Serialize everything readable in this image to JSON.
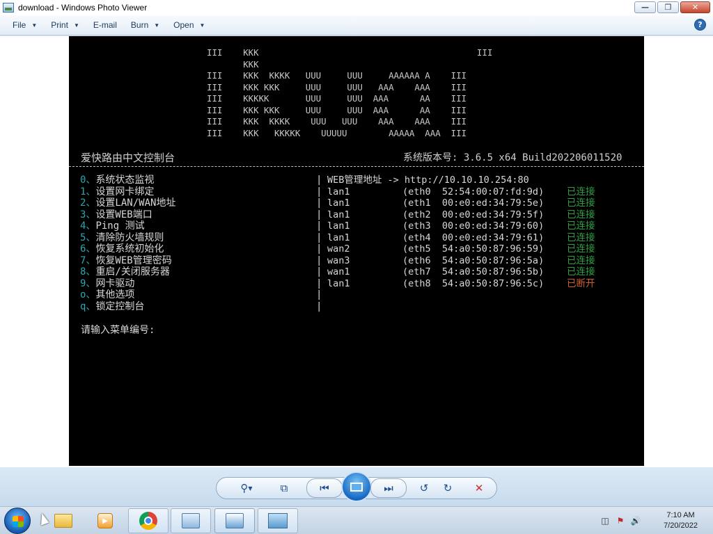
{
  "window": {
    "title": "download - Windows Photo Viewer"
  },
  "menubar": {
    "items": [
      "File",
      "Print",
      "E-mail",
      "Burn",
      "Open"
    ]
  },
  "console": {
    "logo_lines": [
      "III    KKK                                          III",
      "       KKK",
      "III    KKK  KKKK   UUU     UUU     AAAAAA A    III",
      "III    KKK KKK     UUU     UUU   AAA    AAA    III",
      "III    KKKKK       UUU     UUU  AAA      AA    III",
      "III    KKK KKK     UUU     UUU  AAA      AA    III",
      "III    KKK  KKKK    UUU   UUU    AAA    AAA    III",
      "III    KKK   KKKKK    UUUUU        AAAAA  AAA  III"
    ],
    "title": "爱快路由中文控制台",
    "version": "系统版本号: 3.6.5 x64 Build202206011520",
    "menu": [
      {
        "key": "0、",
        "label": "系统状态监视"
      },
      {
        "key": "1、",
        "label": "设置网卡绑定"
      },
      {
        "key": "2、",
        "label": "设置LAN/WAN地址"
      },
      {
        "key": "3、",
        "label": "设置WEB端口"
      },
      {
        "key": "4、",
        "label": "Ping 测试"
      },
      {
        "key": "5、",
        "label": "清除防火墙规则"
      },
      {
        "key": "6、",
        "label": "恢复系统初始化"
      },
      {
        "key": "7、",
        "label": "恢复WEB管理密码"
      },
      {
        "key": "8、",
        "label": "重启/关闭服务器"
      },
      {
        "key": "9、",
        "label": "网卡驱动"
      },
      {
        "key": "o、",
        "label": "其他选项"
      },
      {
        "key": "q、",
        "label": "锁定控制台"
      }
    ],
    "web_addr": "WEB管理地址 -> http://10.10.10.254:80",
    "nics": [
      {
        "name": "lan1",
        "dev": "(eth0  52:54:00:07:fd:9d)",
        "status": "已连接",
        "up": true
      },
      {
        "name": "lan1",
        "dev": "(eth1  00:e0:ed:34:79:5e)",
        "status": "已连接",
        "up": true
      },
      {
        "name": "lan1",
        "dev": "(eth2  00:e0:ed:34:79:5f)",
        "status": "已连接",
        "up": true
      },
      {
        "name": "lan1",
        "dev": "(eth3  00:e0:ed:34:79:60)",
        "status": "已连接",
        "up": true
      },
      {
        "name": "lan1",
        "dev": "(eth4  00:e0:ed:34:79:61)",
        "status": "已连接",
        "up": true
      },
      {
        "name": "wan2",
        "dev": "(eth5  54:a0:50:87:96:59)",
        "status": "已连接",
        "up": true
      },
      {
        "name": "wan3",
        "dev": "(eth6  54:a0:50:87:96:5a)",
        "status": "已连接",
        "up": true
      },
      {
        "name": "wan1",
        "dev": "(eth7  54:a0:50:87:96:5b)",
        "status": "已连接",
        "up": true
      },
      {
        "name": "lan1",
        "dev": "(eth8  54:a0:50:87:96:5c)",
        "status": "已断开",
        "up": false
      }
    ],
    "prompt": "请输入菜单编号:",
    "colors": {
      "menu_key": "#2aa7b0",
      "connected": "#2ea043",
      "disconnected": "#d0602a"
    }
  },
  "controls": {
    "icons": [
      "zoom-icon",
      "actual-size-icon",
      "previous-icon",
      "slideshow-icon",
      "next-icon",
      "rotate-left-icon",
      "rotate-right-icon",
      "delete-icon"
    ]
  },
  "taskbar": {
    "apps": [
      "explorer-icon",
      "media-player-icon",
      "chrome-icon",
      "network-icon",
      "remote-desktop-icon",
      "photo-viewer-icon"
    ],
    "clock_time": "7:10 AM",
    "clock_date": "7/20/2022"
  }
}
